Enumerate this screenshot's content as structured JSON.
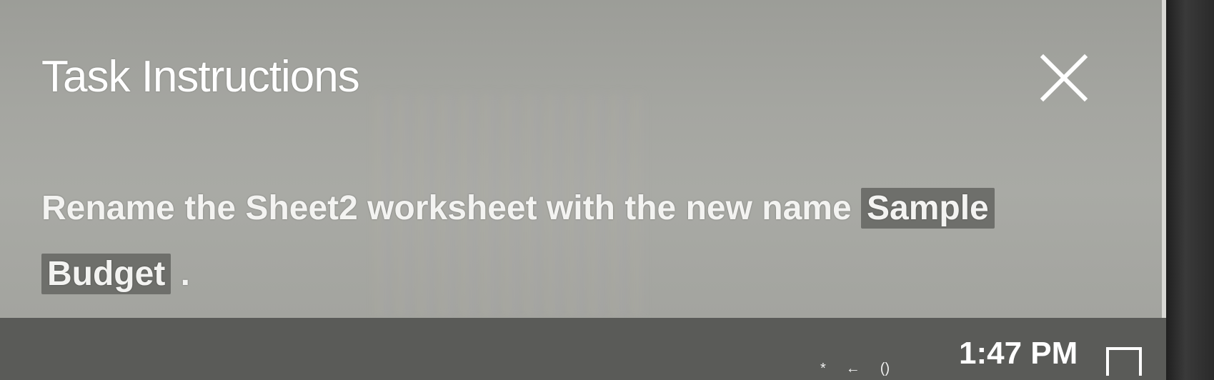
{
  "panel": {
    "title": "Task Instructions",
    "instruction_parts": {
      "prefix": "Rename the Sheet2 worksheet with the new name ",
      "highlight_1": "Sample",
      "highlight_2": "Budget",
      "suffix": " ."
    }
  },
  "taskbar": {
    "clock": "1:47 PM",
    "tray": {
      "bluetooth_glyph": "*",
      "network_glyph": "←",
      "volume_glyph": "()"
    }
  },
  "icons": {
    "close": "close-icon",
    "notification": "notification-icon"
  },
  "colors": {
    "panel_background": "#a5a6a1",
    "highlight_background": "#6e6f6b",
    "text": "#ffffff"
  }
}
